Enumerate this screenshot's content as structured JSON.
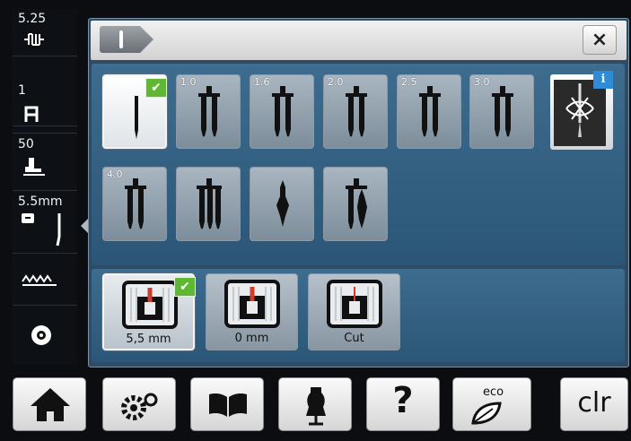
{
  "status": {
    "stitch_width": "5.25",
    "stitch_width_icon": "stitch-width-icon",
    "stitch_length": "1",
    "stitch_length_icon": "stitch-length-icon",
    "presser_pressure": "50",
    "presser_foot_icon": "presser-foot-icon",
    "needle_position": "5.5mm",
    "needle_icon": "needle-indicator-icon",
    "feed_dog_icon": "feed-dog-icon",
    "bobbin_icon": "bobbin-icon"
  },
  "header": {
    "tab_icon": "needle-icon",
    "close_label": "×"
  },
  "needles": [
    {
      "label": "",
      "type": "single",
      "selected": true
    },
    {
      "label": "1.0",
      "type": "twin"
    },
    {
      "label": "1.6",
      "type": "twin"
    },
    {
      "label": "2.0",
      "type": "twin"
    },
    {
      "label": "2.5",
      "type": "twin"
    },
    {
      "label": "3.0",
      "type": "twin"
    },
    {
      "label": "4.0",
      "type": "twin"
    },
    {
      "label": "",
      "type": "triple"
    },
    {
      "label": "",
      "type": "wing"
    },
    {
      "label": "",
      "type": "double-wing"
    }
  ],
  "needle_info_badge": "i",
  "plates": [
    {
      "label": "5,5 mm",
      "selected": true
    },
    {
      "label": "0 mm",
      "selected": false
    },
    {
      "label": "Cut",
      "selected": false
    }
  ],
  "bottom": {
    "home_icon": "home-icon",
    "settings_icon": "settings-icon",
    "tutorial_icon": "book-icon",
    "creative_icon": "dress-form-icon",
    "help_label": "?",
    "eco_label": "eco",
    "clr_label": "clr"
  },
  "colors": {
    "accent_check": "#5fb734",
    "info": "#2e8bd8",
    "panel": "#2e4c66"
  }
}
